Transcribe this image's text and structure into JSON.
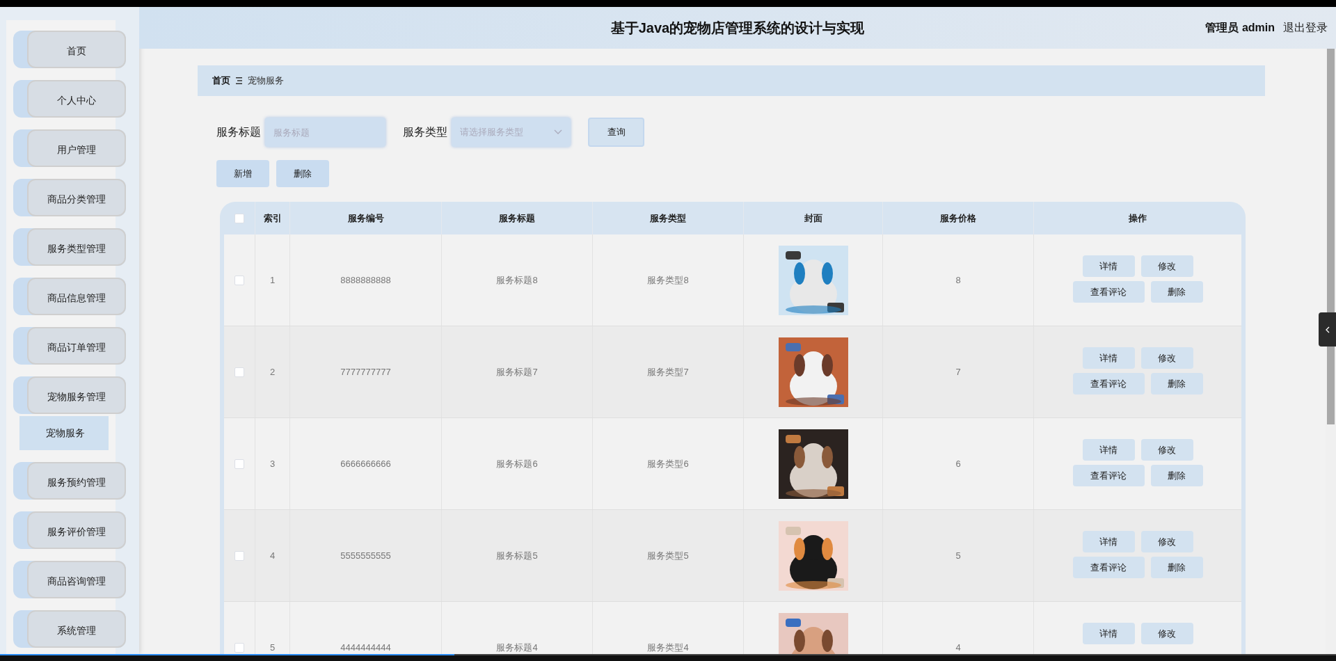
{
  "header": {
    "title": "基于Java的宠物店管理系统的设计与实现",
    "user": "管理员 admin",
    "logout": "退出登录"
  },
  "sidebar": {
    "items": [
      {
        "label": "首页"
      },
      {
        "label": "个人中心"
      },
      {
        "label": "用户管理"
      },
      {
        "label": "商品分类管理"
      },
      {
        "label": "服务类型管理"
      },
      {
        "label": "商品信息管理"
      },
      {
        "label": "商品订单管理"
      },
      {
        "label": "宠物服务管理",
        "children": [
          {
            "label": "宠物服务",
            "selected": true
          }
        ]
      },
      {
        "label": "服务预约管理"
      },
      {
        "label": "服务评价管理"
      },
      {
        "label": "商品咨询管理"
      },
      {
        "label": "系统管理"
      }
    ]
  },
  "breadcrumb": [
    "首页",
    "宠物服务"
  ],
  "search": {
    "fields": [
      {
        "kind": "input",
        "label": "服务标题",
        "placeholder": "服务标题"
      },
      {
        "kind": "select",
        "label": "服务类型",
        "placeholder": "请选择服务类型"
      }
    ],
    "button": "查询"
  },
  "actions": [
    "新增",
    "删除"
  ],
  "table": {
    "select_all": {
      "checked": false
    },
    "columns": [
      "索引",
      "服务编号",
      "服务标题",
      "服务类型",
      "封面",
      "服务价格",
      "操作"
    ],
    "rows": [
      {
        "checked": false,
        "index": "1",
        "code": "8888888888",
        "title": "服务标题8",
        "type": "服务类型8",
        "price": "8",
        "actions": [
          "详情",
          "修改",
          "查看评论",
          "删除"
        ]
      },
      {
        "checked": false,
        "index": "2",
        "code": "7777777777",
        "title": "服务标题7",
        "type": "服务类型7",
        "price": "7",
        "actions": [
          "详情",
          "修改",
          "查看评论",
          "删除"
        ]
      },
      {
        "checked": false,
        "index": "3",
        "code": "6666666666",
        "title": "服务标题6",
        "type": "服务类型6",
        "price": "6",
        "actions": [
          "详情",
          "修改",
          "查看评论",
          "删除"
        ]
      },
      {
        "checked": false,
        "index": "4",
        "code": "5555555555",
        "title": "服务标题5",
        "type": "服务类型5",
        "price": "5",
        "actions": [
          "详情",
          "修改",
          "查看评论",
          "删除"
        ]
      },
      {
        "checked": false,
        "index": "5",
        "code": "4444444444",
        "title": "服务标题4",
        "type": "服务类型4",
        "price": "4",
        "actions": [
          "详情",
          "修改"
        ]
      }
    ]
  },
  "player_bar": {
    "level": 0.34
  }
}
